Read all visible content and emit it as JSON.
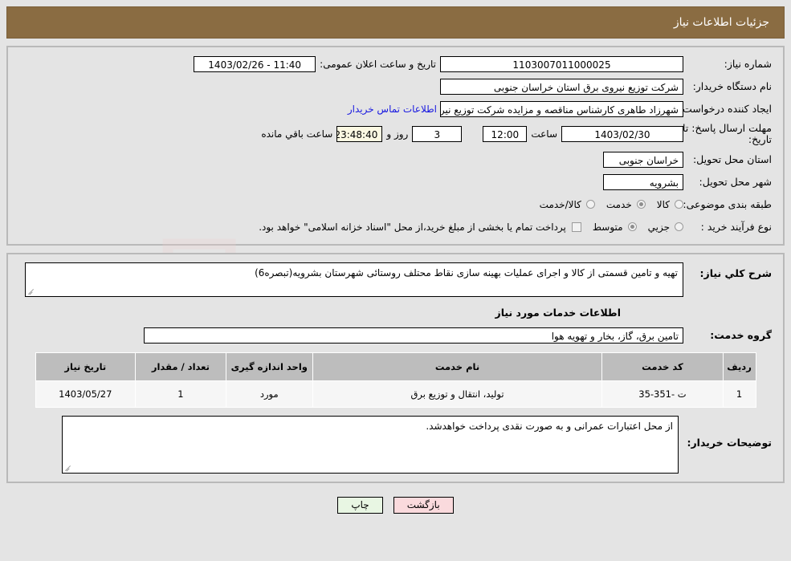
{
  "header": {
    "title": "جزئیات اطلاعات نیاز",
    "bg_color": "#8a6c42",
    "text_color": "#ffffff"
  },
  "watermark": {
    "text": "AriaTender.net"
  },
  "details": {
    "need_number": {
      "label": "شماره نیاز:",
      "value": "1103007011000025"
    },
    "public_announcement": {
      "label": "تاریخ و ساعت اعلان عمومی:",
      "value": "11:40 - 1403/02/26"
    },
    "buyer_org": {
      "label": "نام دستگاه خریدار:",
      "value": "شرکت توزیع نیروی برق استان خراسان جنوبی"
    },
    "request_creator": {
      "label": "ایجاد کننده درخواست:",
      "value": "شهرزاد طاهری کارشناس مناقصه و مزایده شرکت توزیع نیروی برق استان خراسا",
      "contact_link": "اطلاعات تماس خریدار"
    },
    "response_deadline": {
      "label_line1": "مهلت ارسال پاسخ: تا",
      "label_line2": "تاریخ:",
      "date": "1403/02/30",
      "time_label": "ساعت",
      "time": "12:00",
      "days": "3",
      "days_label": "روز و",
      "countdown": "23:48:40",
      "countdown_label": "ساعت باقي مانده"
    },
    "delivery_province": {
      "label": "استان محل تحویل:",
      "value": "خراسان جنوبی"
    },
    "delivery_city": {
      "label": "شهر محل تحویل:",
      "value": "بشرویه"
    },
    "subject_category": {
      "label": "طبقه بندی موضوعی:",
      "options": [
        {
          "label": "کالا",
          "selected": false
        },
        {
          "label": "خدمت",
          "selected": true
        },
        {
          "label": "کالا/خدمت",
          "selected": false
        }
      ]
    },
    "purchase_process": {
      "label": "نوع فرآیند خرید :",
      "options": [
        {
          "label": "جزیي",
          "selected": false
        },
        {
          "label": "متوسط",
          "selected": true
        }
      ],
      "checkbox_label": "",
      "note": "پرداخت تمام یا بخشی از مبلغ خرید،از محل \"اسناد خزانه اسلامی\" خواهد بود."
    }
  },
  "general_description": {
    "label": "شرح کلي نیاز:",
    "value": "تهیه و تامین قسمتی از کالا و اجرای عملیات بهینه سازی  نقاط محتلف روستائی شهرستان بشرویه(تبصره6)"
  },
  "services_section": {
    "heading": "اطلاعات خدمات مورد نیاز",
    "service_group": {
      "label": "گروه خدمت:",
      "value": "تامین برق، گاز، بخار و تهویه هوا"
    },
    "table": {
      "columns": [
        "ردیف",
        "کد خدمت",
        "نام خدمت",
        "واحد اندازه گیری",
        "تعداد / مقدار",
        "تاریخ نیاز"
      ],
      "rows": [
        {
          "radif": "1",
          "code": "ت -351-35",
          "name": "تولید، انتقال و توزیع برق",
          "unit": "مورد",
          "quantity": "1",
          "need_date": "1403/05/27"
        }
      ]
    }
  },
  "buyer_notes": {
    "label": "توضیحات خریدار:",
    "value": "از محل اعتبارات عمرانی و به صورت نقدی پرداخت خواهدشد."
  },
  "footer": {
    "back_button": "بازگشت",
    "print_button": "چاپ"
  }
}
